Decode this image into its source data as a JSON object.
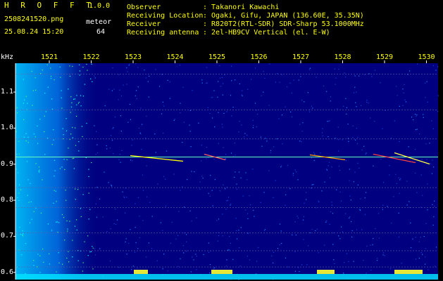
{
  "header": {
    "app_title": "H R O F F T",
    "version": "1.0.0",
    "filename": "2508241520.png",
    "datetime": "25.08.24 15:20",
    "counter_label": "meteor",
    "counter_value": "64",
    "info": [
      {
        "key": "Observer",
        "value": ": Takanori Kawachi"
      },
      {
        "key": "Receiving Location",
        "value": ": Ogaki, Gifu, JAPAN (136.60E, 35.35N)"
      },
      {
        "key": "Receiver",
        "value": ": R820T2(RTL-SDR) SDR-Sharp 53.1000MHz"
      },
      {
        "key": "Receiving antenna",
        "value": ": 2el-HB9CV Vertical (el. E-W)"
      }
    ]
  },
  "chart_data": {
    "type": "heatmap",
    "ylabel": "kHz",
    "x_ticks": [
      "1521",
      "1522",
      "1523",
      "1524",
      "1525",
      "1526",
      "1527",
      "1528",
      "1529",
      "1530"
    ],
    "y_ticks": [
      "1.1",
      "1.0",
      "0.9",
      "0.8",
      "0.7",
      "0.6"
    ],
    "y_range": [
      0.58,
      1.18
    ],
    "carrier_khz": 0.92,
    "colors": {
      "background": "#000080",
      "noise_high": "#00ffff",
      "text": "#ffff00",
      "grid": "#ffffff"
    }
  }
}
